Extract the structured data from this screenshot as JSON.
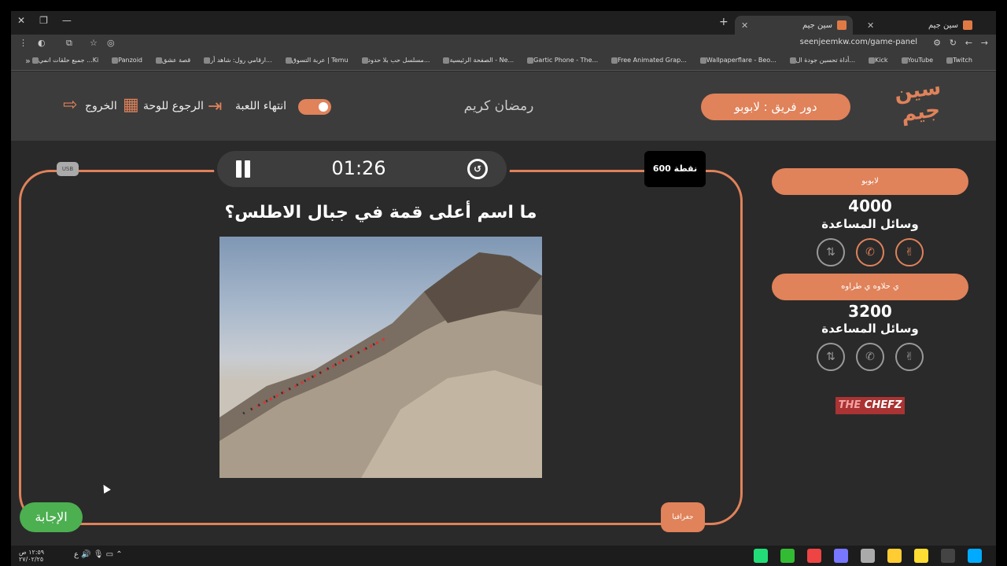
{
  "browser": {
    "tabs": [
      {
        "label": "سين جيم",
        "active": false
      },
      {
        "label": "سين جيم",
        "active": true
      }
    ],
    "url": "seenjeemkw.com/game-panel",
    "bookmarks": [
      "Twitch",
      "YouTube",
      "Kick",
      "أداة تحسين جودة ال...",
      "Wallpaperflare - Beo...",
      "Free Animated Grap...",
      "Gartic Phone - The...",
      "الصفحة الرئيسية - Ne...",
      "مسلسل حب بلا حدود...",
      "عربة التسوق | Temu",
      "ارقامي رول: شاهد أر...",
      "قصة عشق",
      "Panzoid",
      "جميع حلقات انمي ...Ki"
    ]
  },
  "header": {
    "logo_text": "سين جيم",
    "turn_label": "دور فريق : لابوبو",
    "player_name": "رمضان كريم",
    "end_game_label": "انتهاء اللعبة",
    "back_to_board_label": "الرجوع للوحة",
    "exit_label": "الخروج"
  },
  "question": {
    "timer": "01:26",
    "points": "600 نقطة",
    "small_badge": "USB",
    "text": "ما اسم أعلى قمة في جبال الاطلس؟",
    "category": "جغرافيا",
    "answer_label": "الإجابة"
  },
  "teams": [
    {
      "name": "لابوبو",
      "score": "4000",
      "aids_label": "وسائل المساعدة",
      "aids": [
        {
          "icon": "hand-peace-icon",
          "active": true
        },
        {
          "icon": "phone-icon",
          "active": true
        },
        {
          "icon": "swap-icon",
          "active": false
        }
      ]
    },
    {
      "name": "ي حلاوه ي طراوه",
      "score": "3200",
      "aids_label": "وسائل المساعدة",
      "aids": [
        {
          "icon": "hand-peace-icon",
          "active": false
        },
        {
          "icon": "phone-icon",
          "active": false
        },
        {
          "icon": "swap-icon",
          "active": false
        }
      ]
    }
  ],
  "sponsor": {
    "part1": "THE",
    "part2": "CHEFZ"
  },
  "taskbar": {
    "time": "١٢:٥٩ ص",
    "date": "٢٧/٠٢/٢٥"
  },
  "colors": {
    "accent": "#e0825a",
    "answer": "#4caf50",
    "bg": "#2a2a2a",
    "header": "#3c3c3c"
  }
}
